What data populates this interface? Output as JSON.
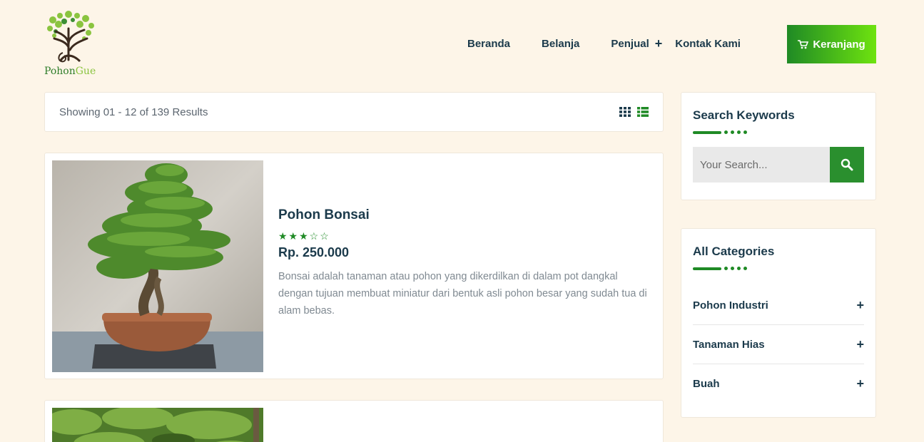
{
  "brand": {
    "name_part1": "Pohon",
    "name_part2": "Gue"
  },
  "nav": {
    "items": [
      {
        "label": "Beranda"
      },
      {
        "label": "Belanja"
      },
      {
        "label": "Penjual"
      },
      {
        "label": "Kontak Kami"
      }
    ],
    "penjual_expand_icon": "+",
    "cart_label": "Keranjang",
    "cart_icon": "cart-icon"
  },
  "results": {
    "text": "Showing 01 - 12 of 139 Results",
    "view_icons": [
      "grid-view-icon",
      "list-view-icon"
    ]
  },
  "products": [
    {
      "name": "Pohon Bonsai",
      "rating": 3,
      "rating_max": 5,
      "stars_text": "★★★☆☆",
      "price": "Rp. 250.000",
      "description": "Bonsai adalah tanaman atau pohon yang dikerdilkan di dalam pot dangkal dengan tujuan membuat miniatur dari bentuk asli pohon besar yang sudah tua di alam bebas."
    }
  ],
  "sidebar": {
    "search": {
      "title": "Search Keywords",
      "placeholder": "Your Search..."
    },
    "categories": {
      "title": "All Categories",
      "items": [
        {
          "label": "Pohon Industri",
          "icon": "+"
        },
        {
          "label": "Tanaman Hias",
          "icon": "+"
        },
        {
          "label": "Buah",
          "icon": "+"
        }
      ]
    }
  },
  "colors": {
    "background": "#fdf5e8",
    "accent": "#1f8a25",
    "accent_light": "#6ee30f",
    "text_dark": "#1b3a4b"
  }
}
